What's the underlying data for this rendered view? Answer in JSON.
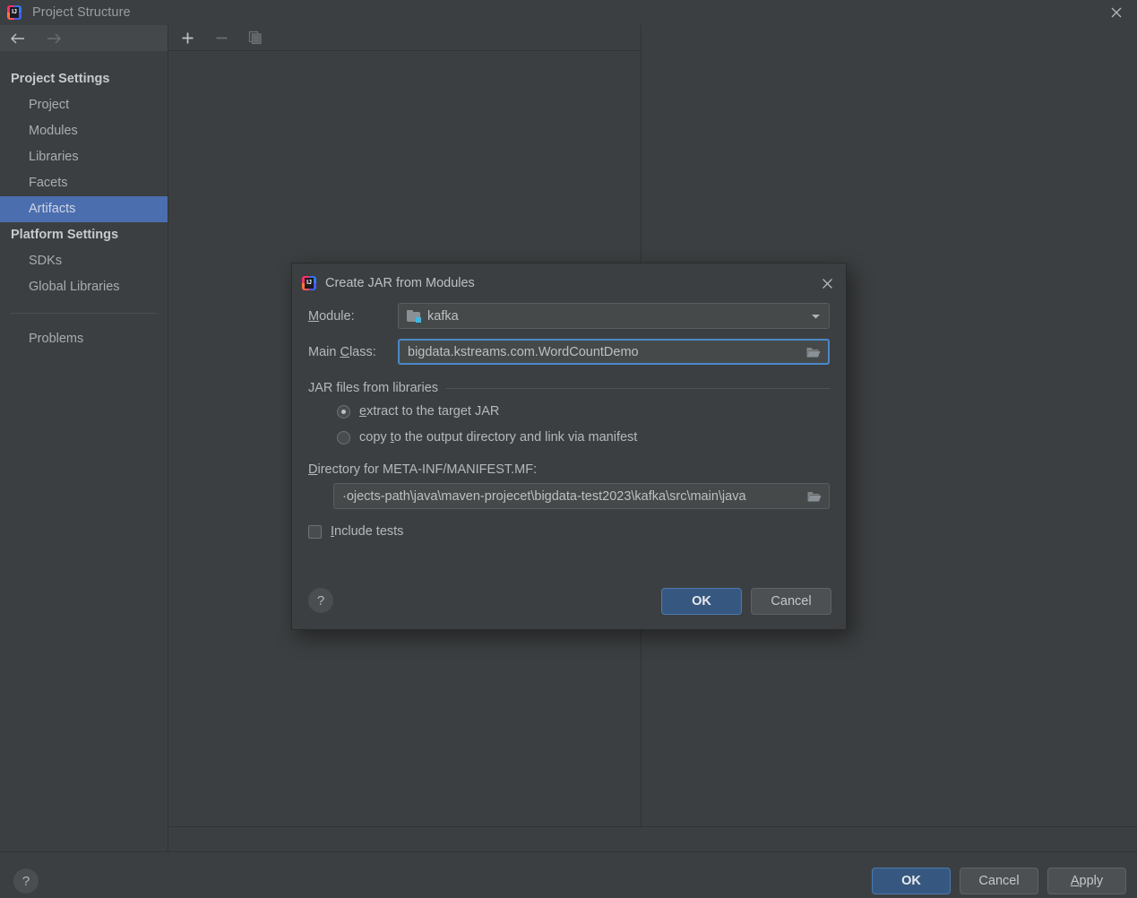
{
  "window": {
    "title": "Project Structure",
    "logo_icon": "intellij-idea-logo",
    "close_icon": "close-icon"
  },
  "nav": {
    "back_icon": "arrow-left-icon",
    "forward_icon": "arrow-right-icon"
  },
  "sidebar": {
    "groups": [
      {
        "header": "Project Settings",
        "items": [
          {
            "label": "Project",
            "selected": false
          },
          {
            "label": "Modules",
            "selected": false
          },
          {
            "label": "Libraries",
            "selected": false
          },
          {
            "label": "Facets",
            "selected": false
          },
          {
            "label": "Artifacts",
            "selected": true
          }
        ]
      },
      {
        "header": "Platform Settings",
        "items": [
          {
            "label": "SDKs",
            "selected": false
          },
          {
            "label": "Global Libraries",
            "selected": false
          }
        ]
      }
    ],
    "problems": {
      "label": "Problems"
    }
  },
  "toolbar": {
    "add_icon": "plus-icon",
    "remove_icon": "minus-icon",
    "copy_icon": "copy-icon"
  },
  "footer": {
    "help_label": "?",
    "ok_label": "OK",
    "cancel_label": "Cancel",
    "apply_label": "Apply",
    "apply_mnemonic": "A",
    "apply_rest": "pply"
  },
  "dialog": {
    "logo_icon": "intellij-idea-logo",
    "title": "Create JAR from Modules",
    "close_icon": "close-icon",
    "module": {
      "label_mnemonic": "M",
      "label_rest": "odule:",
      "icon": "module-folder-icon",
      "value": "kafka",
      "dropdown_icon": "chevron-down-icon"
    },
    "main_class": {
      "label_prefix": "Main ",
      "label_mnemonic": "C",
      "label_rest": "lass:",
      "value": "bigdata.kstreams.com.WordCountDemo",
      "browse_icon": "folder-open-icon"
    },
    "jar_group": {
      "title": "JAR files from libraries",
      "options": [
        {
          "mnemonic": "e",
          "rest": "xtract to the target JAR",
          "full_label": "extract to the target JAR",
          "selected": true
        },
        {
          "prefix": "copy ",
          "mnemonic": "t",
          "rest": "o the output directory and link via manifest",
          "full_label": "copy to the output directory and link via manifest",
          "selected": false
        }
      ]
    },
    "manifest": {
      "label_mnemonic": "D",
      "label_rest": "irectory for META-INF/MANIFEST.MF:",
      "value": "·ojects-path\\java\\maven-projecet\\bigdata-test2023\\kafka\\src\\main\\java",
      "browse_icon": "folder-open-icon"
    },
    "include_tests": {
      "mnemonic": "I",
      "rest": "nclude tests",
      "checked": false
    },
    "footer": {
      "help_label": "?",
      "ok_label": "OK",
      "cancel_label": "Cancel"
    }
  },
  "colors": {
    "background": "#3c3f41",
    "selection_blue": "#4b6eaf",
    "primary_button": "#365880",
    "focus_border": "#4a88c7",
    "module_badge": "#40b6e0"
  }
}
